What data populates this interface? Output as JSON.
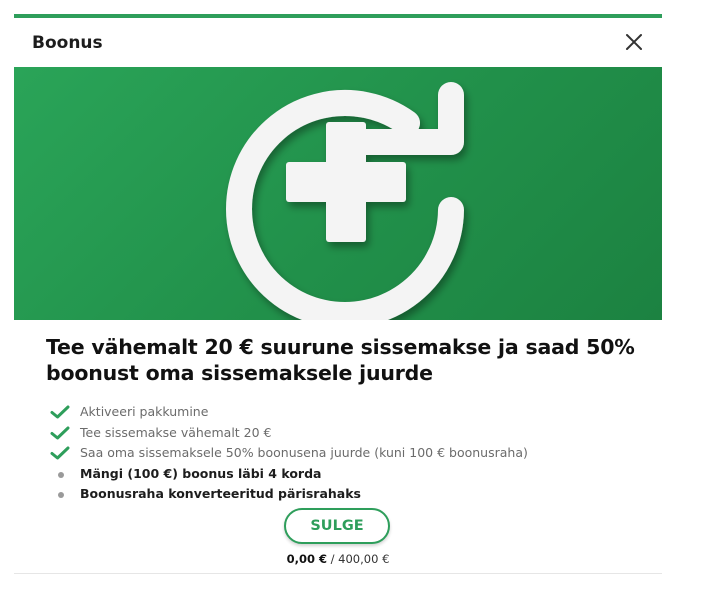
{
  "dialog": {
    "title": "Boonus",
    "close_icon": "close-icon"
  },
  "hero": {
    "icon": "refresh-plus-icon",
    "background_color": "#24994f"
  },
  "offer": {
    "title": "Tee vähemalt 20 € suurune sissemakse ja saad 50% boonust oma sissemaksele juurde",
    "steps": [
      {
        "label": "Aktiveeri pakkumine",
        "status": "done",
        "icon": "check-icon"
      },
      {
        "label": "Tee sissemakse vähemalt 20 €",
        "status": "done",
        "icon": "check-icon"
      },
      {
        "label": "Saa oma sissemaksele 50% boonusena juurde (kuni 100 € boonusraha)",
        "status": "done",
        "icon": "check-icon"
      },
      {
        "label": "Mängi (100 €) boonus läbi 4 korda",
        "status": "pending",
        "icon": "bullet-icon"
      },
      {
        "label": "Boonusraha konverteeritud pärisrahaks",
        "status": "pending",
        "icon": "bullet-icon"
      }
    ]
  },
  "actions": {
    "close_label": "SULGE"
  },
  "progress": {
    "current": "0,00 €",
    "separator": " / ",
    "total": "400,00 €"
  },
  "colors": {
    "accent": "#2e9e5b",
    "check": "#2e9e5b"
  }
}
